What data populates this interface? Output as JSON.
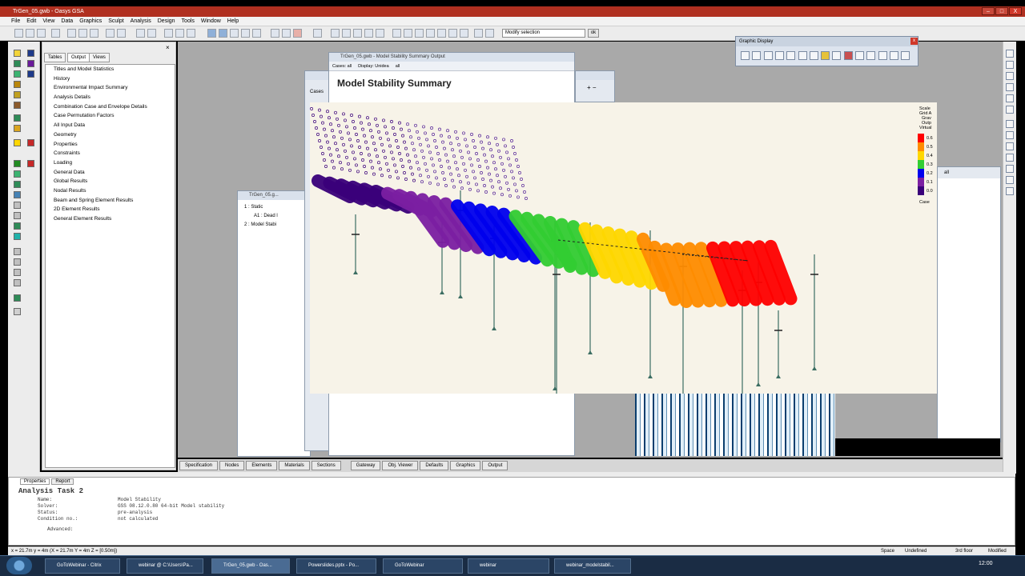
{
  "window": {
    "title": "TrGen_05.gwb - Oasys GSA",
    "minimize": "–",
    "maximize": "□",
    "close": "X"
  },
  "menu": [
    "File",
    "Edit",
    "View",
    "Data",
    "Graphics",
    "Sculpt",
    "Analysis",
    "Design",
    "Tools",
    "Window",
    "Help"
  ],
  "toolbar": {
    "selection_mode": "Modify selection",
    "ok_label": "ok"
  },
  "gateway": {
    "tabs": [
      "Tables",
      "Output",
      "Views"
    ],
    "tree": [
      "Titles and Model Statistics",
      "History",
      "Environmental Impact Summary",
      "Analysis Details",
      "Combination Case and Envelope Details",
      "Case Permutation Factors",
      "All Input Data",
      "Geometry",
      "Properties",
      "Constraints",
      "Loading",
      "General Data",
      "Global Results",
      "Nodal Results",
      "Beam and Spring Element Results",
      "2D Element Results",
      "General Element Results"
    ]
  },
  "windows": {
    "stability_title": "TrGen_05.gwb - Model Stability Summary Output",
    "stability_heading": "Model Stability Summary",
    "stability_bar": [
      "Cases: all",
      "Display: Unidea",
      "all"
    ],
    "small_title": "TrGen_05.g...",
    "tree2": [
      "1 : Static",
      "A1 : Dead l",
      "2 : Model Stabi"
    ],
    "case_label": "Cases",
    "all_label": "all"
  },
  "graphic_display": {
    "title": "Graphic Display"
  },
  "legend": {
    "labels": [
      "Scale",
      "Grid A",
      "Grav",
      "Outp",
      "Virtual"
    ],
    "values": [
      "0.6",
      "0.5",
      "0.4",
      "0.3",
      "0.2",
      "0.1",
      "0.0"
    ],
    "colors": [
      "#ff0000",
      "#ff8c00",
      "#ffd700",
      "#32cd32",
      "#0000ee",
      "#7b1fa2",
      "#3a007a"
    ],
    "case_label": "Case"
  },
  "bottom_tabs": [
    "Specification",
    "Nodes",
    "Elements",
    "Materials",
    "Sections",
    "Gateway",
    "Obj. Viewer",
    "Defaults",
    "Graphics",
    "Output"
  ],
  "properties": {
    "tabs": [
      "Properties",
      "Report"
    ],
    "heading": "Analysis Task 2",
    "rows": [
      {
        "k": "Name:",
        "v": "Model Stability"
      },
      {
        "k": "Solver:",
        "v": "GSS 08.12.0.80 64-bit Model stability"
      },
      {
        "k": "Status:",
        "v": "pre-analysis"
      },
      {
        "k": "Condition no.:",
        "v": "not calculated"
      }
    ],
    "advanced": "Advanced:"
  },
  "status": {
    "coords": "x = 21.7m  y = 4m  (X = 21.7m  Y = 4m  Z = [0.50m])",
    "right": [
      "Space",
      "Undefined",
      "3rd floor",
      "Modified"
    ]
  },
  "taskbar": {
    "tasks": [
      "GoToWebinar - Citrix",
      "webinar @ C:\\Users\\Pa...",
      "TrGen_05.gwb - Oas...",
      "Powerslides.pptx - Po...",
      "GoToWebinar",
      "webinar",
      "webinar_modelstabil..."
    ],
    "clock": "12:00"
  }
}
